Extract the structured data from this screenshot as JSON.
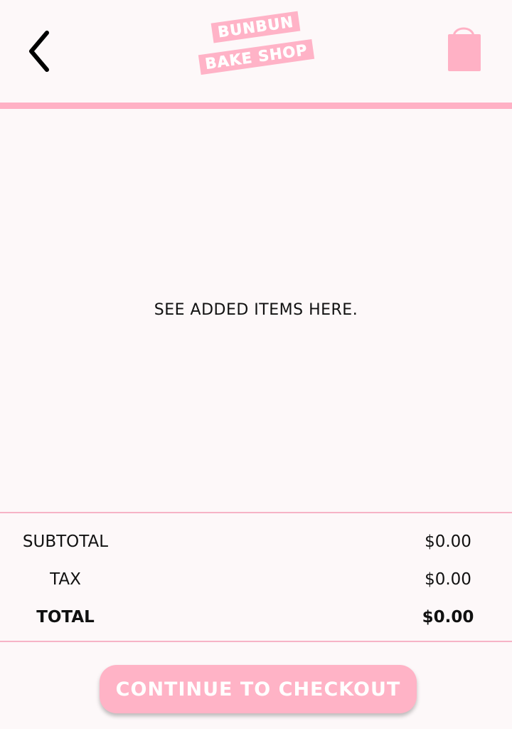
{
  "header": {
    "back_icon": "chevron-left-icon",
    "logo_line1": "BUNBUN",
    "logo_line2": "BAKE SHOP",
    "bag_icon": "shopping-bag-icon"
  },
  "colors": {
    "accent_pink": "#ffb1c5",
    "background": "#fdf8f9",
    "text": "#111111"
  },
  "cart": {
    "empty_message": "SEE ADDED ITEMS HERE."
  },
  "summary": {
    "subtotal_label": "SUBTOTAL",
    "subtotal_value": "$0.00",
    "tax_label": "TAX",
    "tax_value": "$0.00",
    "total_label": "TOTAL",
    "total_value": "$0.00"
  },
  "checkout": {
    "label": "CONTINUE TO CHECKOUT"
  }
}
